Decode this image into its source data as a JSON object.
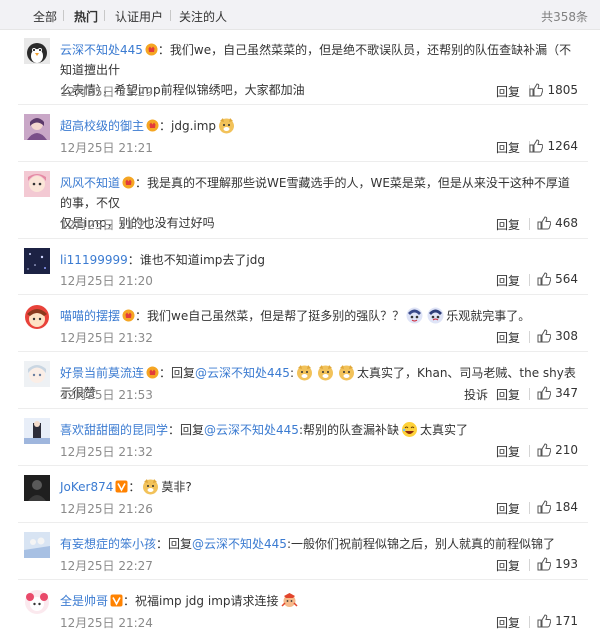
{
  "tabs": {
    "all": "全部",
    "hot": "热门",
    "verified": "认证用户",
    "following": "关注的人",
    "total": "共358条"
  },
  "actions": {
    "reply": "回复",
    "report": "投诉"
  },
  "colors": {
    "username": "#eb7350",
    "link": "#3b7bd1",
    "tab_bg": "#f2f2f5"
  },
  "comments": [
    {
      "user": "云深不知处445",
      "badge": "vip-badge-icon",
      "text_1": "：我们we，自己虽然菜菜的，但是绝不歌误队员，还帮别的队伍查缺补漏（不知道擅出什",
      "text_2": "么表情），希望imp前程似锦绣吧，大家都加油",
      "time": "12月25日 21:29",
      "likes": "1805"
    },
    {
      "user": "超高校级的御主",
      "badge": "vip-badge-icon",
      "text": "：jdg.imp",
      "emoji": "doge-emoji-icon",
      "time": "12月25日 21:21",
      "likes": "1264"
    },
    {
      "user": "风风不知道",
      "badge": "vip-badge-icon",
      "text_1": "：我是真的不理解那些说WE雪藏选手的人，WE菜是菜，但是从来没干这种不厚道的事，不仅",
      "text_2": "仅是imp，别的也没有过好吗",
      "time": "12月25日 21:21",
      "likes": "468"
    },
    {
      "user": "li11199999",
      "text": "：谁也不知道imp去了jdg",
      "time": "12月25日 21:20",
      "likes": "564"
    },
    {
      "user": "喵喵的摆摆",
      "badge": "vip-badge-icon",
      "text": "：我们we自己虽然菜，但是帮了挺多别的强队？？",
      "text_after": "乐观就完事了。",
      "time": "12月25日 21:32",
      "likes": "308"
    },
    {
      "user": "好景当前莫流连",
      "badge": "vip-badge-icon",
      "prefix": "：回复",
      "mention": "@云深不知处445",
      "text": "太真实了，Khan、司马老贼、the shy表示很赞",
      "time": "12月25日 21:53",
      "likes": "347"
    },
    {
      "user": "喜欢甜甜圈的昆同学",
      "prefix": "：回复",
      "mention": "@云深不知处445",
      "text": ":帮别的队查漏补缺",
      "text_after": "太真实了",
      "time": "12月25日 21:32",
      "likes": "210"
    },
    {
      "user": "JoKer874",
      "badge": "verified-v-icon",
      "text": "莫非?",
      "time": "12月25日 21:26",
      "likes": "184"
    },
    {
      "user": "有妄想症的笨小孩",
      "prefix": "：回复",
      "mention": "@云深不知处445",
      "text": ":一般你们祝前程似锦之后，别人就真的前程似锦了",
      "time": "12月25日 22:27",
      "likes": "193"
    },
    {
      "user": "全是帅哥",
      "badge": "verified-v-icon",
      "text": "：祝福imp jdg imp请求连接",
      "time": "12月25日 21:24",
      "likes": "171"
    }
  ]
}
